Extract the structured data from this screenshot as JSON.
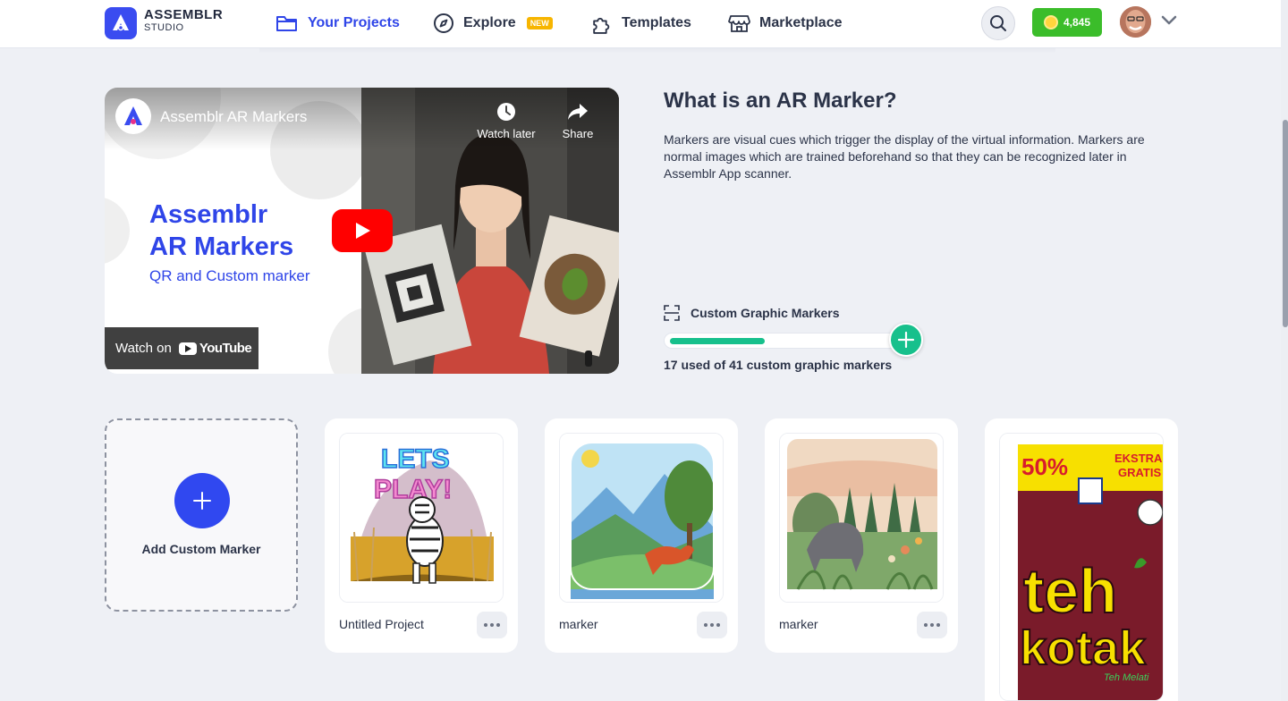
{
  "brand": {
    "name": "ASSEMBLR",
    "sub": "STUDIO"
  },
  "nav": {
    "your_projects": "Your Projects",
    "explore": "Explore",
    "explore_badge": "NEW",
    "templates": "Templates",
    "marketplace": "Marketplace"
  },
  "account": {
    "coins": "4,845"
  },
  "video": {
    "channel_title": "Assemblr AR Markers",
    "watch_later": "Watch later",
    "share": "Share",
    "headline_1": "Assemblr",
    "headline_2": "AR Markers",
    "subline": "QR and Custom marker",
    "watch_on": "Watch on",
    "youtube": "YouTube"
  },
  "info": {
    "title": "What is an AR Marker?",
    "description": "Markers are visual cues which trigger the display of the virtual information. Markers are normal images which are trained beforehand so that they can be recognized later in Assemblr App scanner.",
    "markers_label": "Custom Graphic Markers",
    "usage_text": "17 used of 41 custom graphic markers",
    "used": 17,
    "total": 41
  },
  "cards": {
    "add_label": "Add Custom Marker",
    "items": [
      {
        "name": "Untitled Project"
      },
      {
        "name": "marker"
      },
      {
        "name": "marker"
      }
    ],
    "thumb_text": {
      "lets": "LETS",
      "play": "PLAY!",
      "discount": "50%",
      "promo_1": "EKSTRA",
      "promo_2": "GRATIS",
      "brand_1": "teh",
      "brand_2": "kotak",
      "variant": "Teh Melati"
    }
  },
  "colors": {
    "accent": "#2f45e8",
    "green": "#17c08c",
    "coin": "#3bbd2a"
  }
}
